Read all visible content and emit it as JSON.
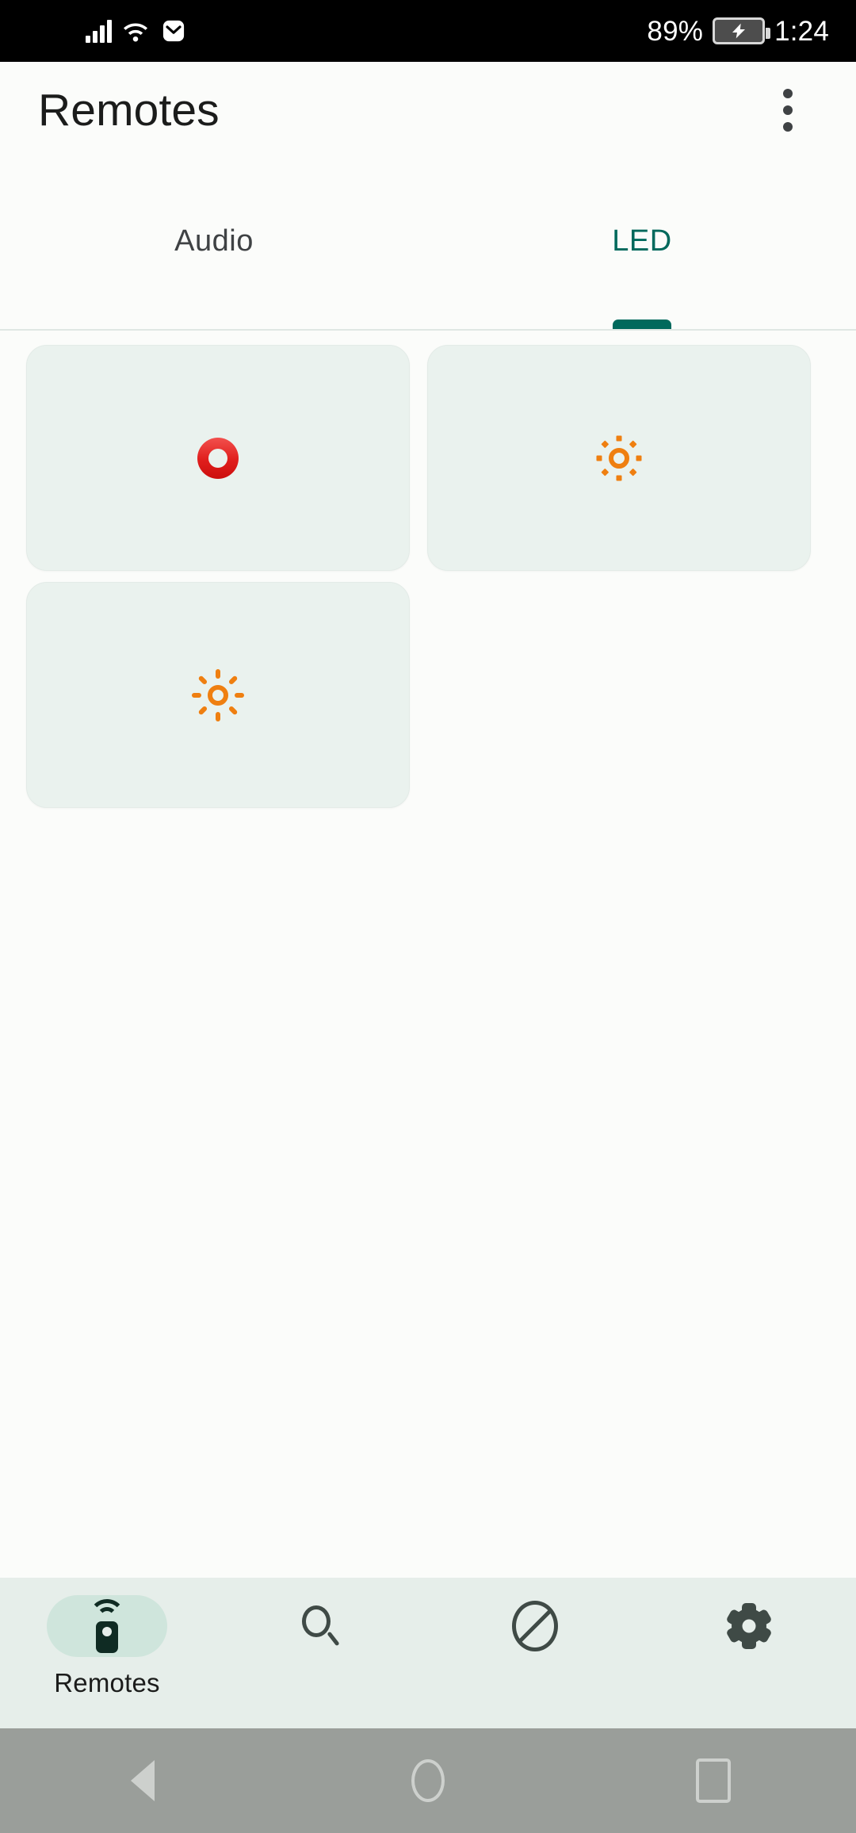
{
  "status_bar": {
    "signal_icon": "cellular-signal-icon",
    "wifi_icon": "wifi-icon",
    "mail_icon": "envelope-icon",
    "battery_percent": "89%",
    "battery_icon": "battery-charging-icon",
    "time": "1:24"
  },
  "app_bar": {
    "title": "Remotes",
    "overflow_icon": "more-vertical-icon"
  },
  "tabs": {
    "items": [
      {
        "label": "Audio",
        "active": false
      },
      {
        "label": "LED",
        "active": true
      }
    ]
  },
  "cards": [
    {
      "icon": "power-ring-icon",
      "kind": "power",
      "span": "full"
    },
    {
      "icon": "brightness-low-icon",
      "kind": "brightness-low",
      "span": "half"
    },
    {
      "icon": "brightness-high-icon",
      "kind": "brightness-high",
      "span": "half"
    }
  ],
  "bottom_nav": {
    "items": [
      {
        "label": "Remotes",
        "icon": "remote-control-icon",
        "active": true
      },
      {
        "label": "",
        "icon": "search-icon",
        "active": false
      },
      {
        "label": "",
        "icon": "block-icon",
        "active": false
      },
      {
        "label": "",
        "icon": "settings-gear-icon",
        "active": false
      }
    ]
  },
  "system_nav": {
    "back": "back-triangle-icon",
    "home": "home-circle-icon",
    "recents": "recents-square-icon"
  },
  "colors": {
    "accent_teal": "#00695c",
    "card_bg": "#eaf2ee",
    "nav_bg": "#e6eeea",
    "active_pill": "#cfe5dc",
    "power_red": "#e01e1c",
    "brightness_orange": "#ef7f10",
    "page_bg": "#fbfcfa",
    "system_nav_bg": "#9a9e9a"
  }
}
